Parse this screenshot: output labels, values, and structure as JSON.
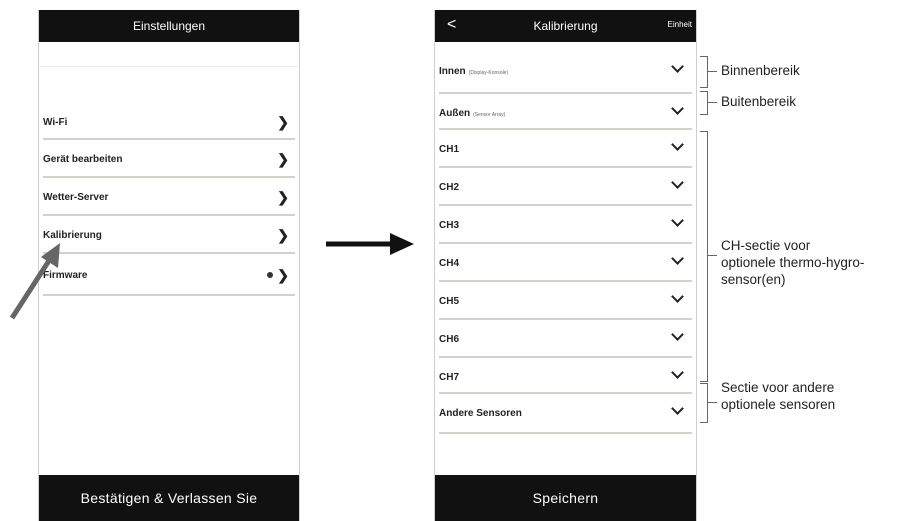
{
  "settings": {
    "title": "Einstellungen",
    "items": [
      {
        "label": "Wi-Fi"
      },
      {
        "label": "Gerät bearbeiten"
      },
      {
        "label": "Wetter-Server"
      },
      {
        "label": "Kalibrierung"
      },
      {
        "label": "Firmware"
      }
    ],
    "confirm_label": "Bestätigen & Verlassen Sie"
  },
  "calibration": {
    "back_glyph": "<",
    "title": "Kalibrierung",
    "unit_label": "Einheit",
    "rows": [
      {
        "label": "Innen",
        "sub": "(Display-Konsole)"
      },
      {
        "label": "Außen",
        "sub": "(Sensor Array)"
      },
      {
        "label": "CH1",
        "sub": ""
      },
      {
        "label": "CH2",
        "sub": ""
      },
      {
        "label": "CH3",
        "sub": ""
      },
      {
        "label": "CH4",
        "sub": ""
      },
      {
        "label": "CH5",
        "sub": ""
      },
      {
        "label": "CH6",
        "sub": ""
      },
      {
        "label": "CH7",
        "sub": ""
      },
      {
        "label": "Andere Sensoren",
        "sub": ""
      }
    ],
    "save_label": "Speichern"
  },
  "annotations": {
    "binnen": "Binnenbereik",
    "buiten": "Buitenbereik",
    "ch_line1": "CH-sectie voor",
    "ch_line2": "optionele thermo-hygro-",
    "ch_line3": "sensor(en)",
    "other_line1": "Sectie voor andere",
    "other_line2": "optionele sensoren"
  },
  "colors": {
    "bar": "#111111",
    "divider": "#d6cfcb",
    "arrow": "#666666"
  }
}
